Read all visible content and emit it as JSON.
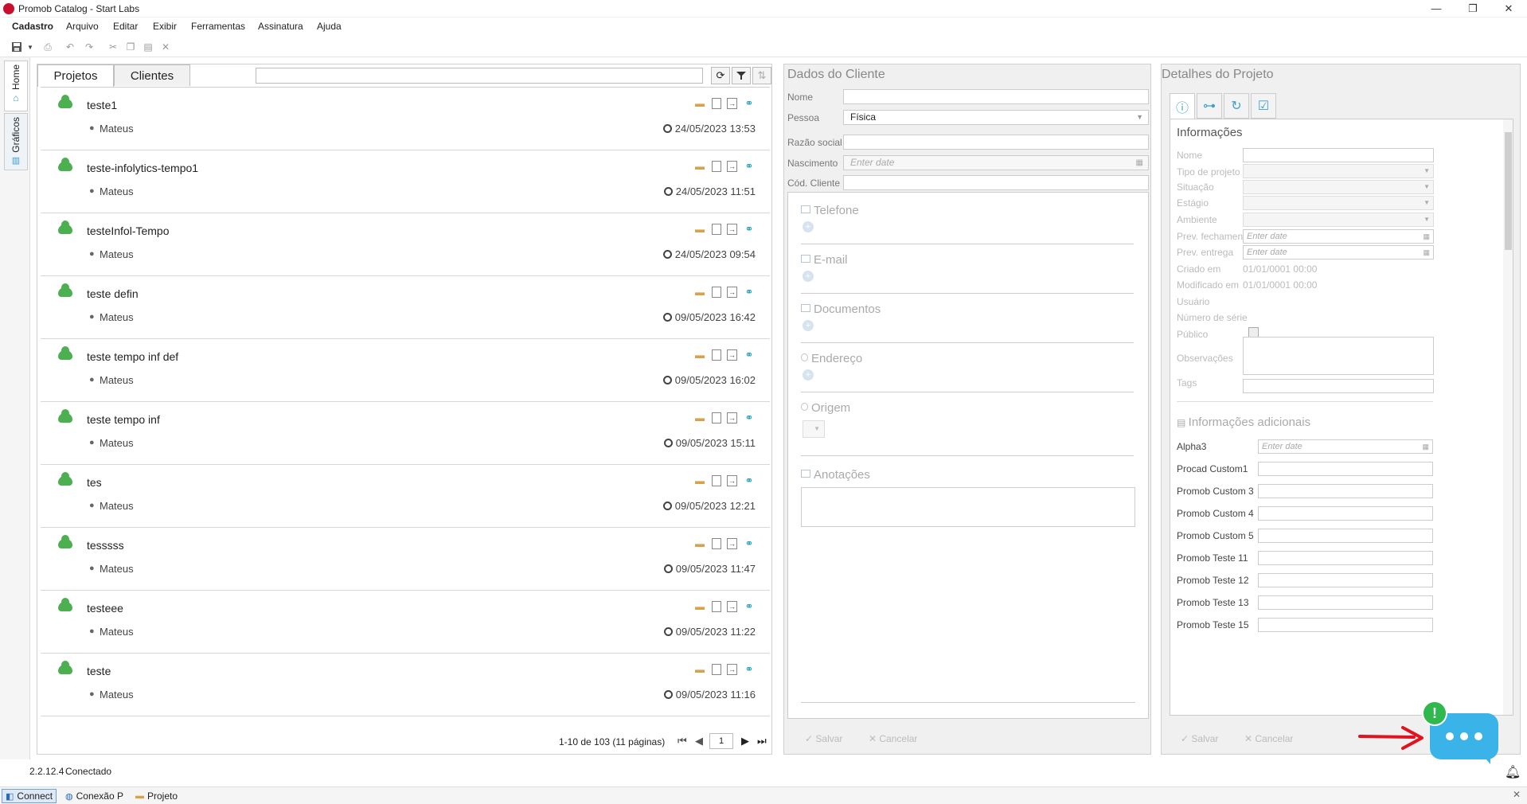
{
  "window": {
    "title": "Promob Catalog - Start Labs",
    "controls": {
      "minimize": "—",
      "maximize": "❐",
      "close": "✕"
    }
  },
  "menu": [
    "Cadastro",
    "Arquivo",
    "Editar",
    "Exibir",
    "Ferramentas",
    "Assinatura",
    "Ajuda"
  ],
  "leftbar": {
    "home": "Home",
    "graficos": "Gráficos"
  },
  "projects_panel": {
    "tabs": [
      "Projetos",
      "Clientes"
    ],
    "search_value": "",
    "rows": [
      {
        "name": "teste1",
        "user": "Mateus",
        "date": "24/05/2023 13:53"
      },
      {
        "name": "teste-infolytics-tempo1",
        "user": "Mateus",
        "date": "24/05/2023 11:51"
      },
      {
        "name": "testeInfol-Tempo",
        "user": "Mateus",
        "date": "24/05/2023 09:54"
      },
      {
        "name": "teste defin",
        "user": "Mateus",
        "date": "09/05/2023 16:42"
      },
      {
        "name": "teste tempo inf def",
        "user": "Mateus",
        "date": "09/05/2023 16:02"
      },
      {
        "name": "teste tempo inf",
        "user": "Mateus",
        "date": "09/05/2023 15:11"
      },
      {
        "name": "tes",
        "user": "Mateus",
        "date": "09/05/2023 12:21"
      },
      {
        "name": "tesssss",
        "user": "Mateus",
        "date": "09/05/2023 11:47"
      },
      {
        "name": "testeee",
        "user": "Mateus",
        "date": "09/05/2023 11:22"
      },
      {
        "name": "teste",
        "user": "Mateus",
        "date": "09/05/2023 11:16"
      }
    ],
    "pagination": {
      "info": "1-10 de 103 (11 páginas)",
      "page": "1"
    }
  },
  "cliente": {
    "title": "Dados do Cliente",
    "fields": {
      "nome_label": "Nome",
      "nome_value": "",
      "pessoa_label": "Pessoa",
      "pessoa_value": "Física",
      "razao_label": "Razão social",
      "nascimento_label": "Nascimento",
      "nascimento_placeholder": "Enter date",
      "cod_label": "Cód. Cliente"
    },
    "sections": [
      "Telefone",
      "E-mail",
      "Documentos",
      "Endereço",
      "Origem",
      "Anotações"
    ],
    "footer": {
      "save": "Salvar",
      "cancel": "Cancelar"
    }
  },
  "detalhes": {
    "title": "Detalhes do Projeto",
    "tab_icons": [
      "info-icon",
      "structure-icon",
      "history-icon",
      "checklist-icon"
    ],
    "info_title": "Informações",
    "fields": {
      "nome": "Nome",
      "tipo": "Tipo de projeto",
      "situacao": "Situação",
      "estagio": "Estágio",
      "ambiente": "Ambiente",
      "prev_fechamento": "Prev. fechamento",
      "prev_entrega": "Prev. entrega",
      "criado": "Criado em",
      "criado_value": "01/01/0001 00:00",
      "modificado": "Modificado em",
      "modificado_value": "01/01/0001 00:00",
      "usuario": "Usuário",
      "serie": "Número de série",
      "publico": "Público",
      "obs": "Observações",
      "tags": "Tags",
      "date_placeholder": "Enter date"
    },
    "additional_title": "Informações adicionais",
    "additional": [
      "Alpha3",
      "Procad Custom1",
      "Promob Custom 3",
      "Promob Custom 4",
      "Promob Custom 5",
      "Promob Teste 11",
      "Promob Teste 12",
      "Promob Teste 13",
      "Promob Teste 15"
    ],
    "footer": {
      "save": "Salvar",
      "cancel": "Cancelar"
    }
  },
  "status": {
    "version": "2.2.12.4",
    "state": "Conectado"
  },
  "taskbar": [
    "Connect",
    "Conexão P",
    "Projeto"
  ],
  "chat": {
    "badge": "!"
  },
  "colors": {
    "accent": "#3ab4e8",
    "cloud": "#4caf50",
    "badge": "#2eb84d",
    "arrow": "#e0141e"
  }
}
